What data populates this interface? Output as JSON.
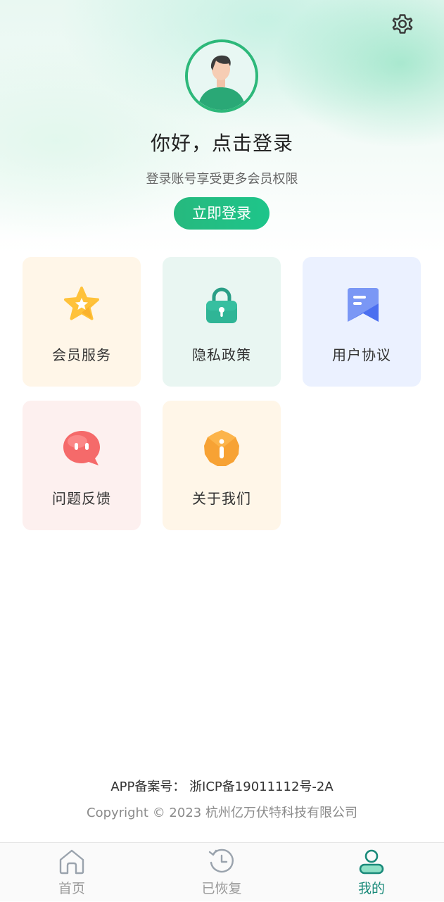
{
  "profile": {
    "greeting": "你好，点击登录",
    "subtitle": "登录账号享受更多会员权限",
    "login_button": "立即登录"
  },
  "menu": {
    "items": [
      {
        "label": "会员服务",
        "icon": "star-icon",
        "bg": "#fff6e8"
      },
      {
        "label": "隐私政策",
        "icon": "lock-icon",
        "bg": "#e9f6f2"
      },
      {
        "label": "用户协议",
        "icon": "document-icon",
        "bg": "#ebf1ff"
      },
      {
        "label": "问题反馈",
        "icon": "chat-bubble-icon",
        "bg": "#fdf0ef"
      },
      {
        "label": "关于我们",
        "icon": "info-icon",
        "bg": "#fff6e8"
      }
    ]
  },
  "footer": {
    "record": "APP备案号： 浙ICP备19011112号-2A",
    "copyright": "Copyright © 2023 杭州亿万伏特科技有限公司"
  },
  "tabbar": {
    "tabs": [
      {
        "label": "首页",
        "icon": "home-icon",
        "active": false
      },
      {
        "label": "已恢复",
        "icon": "history-icon",
        "active": false
      },
      {
        "label": "我的",
        "icon": "user-icon",
        "active": true
      }
    ]
  },
  "colors": {
    "accent": "#26b97e",
    "active_tab": "#1a8a7a",
    "inactive_tab": "#9a9a9a"
  }
}
